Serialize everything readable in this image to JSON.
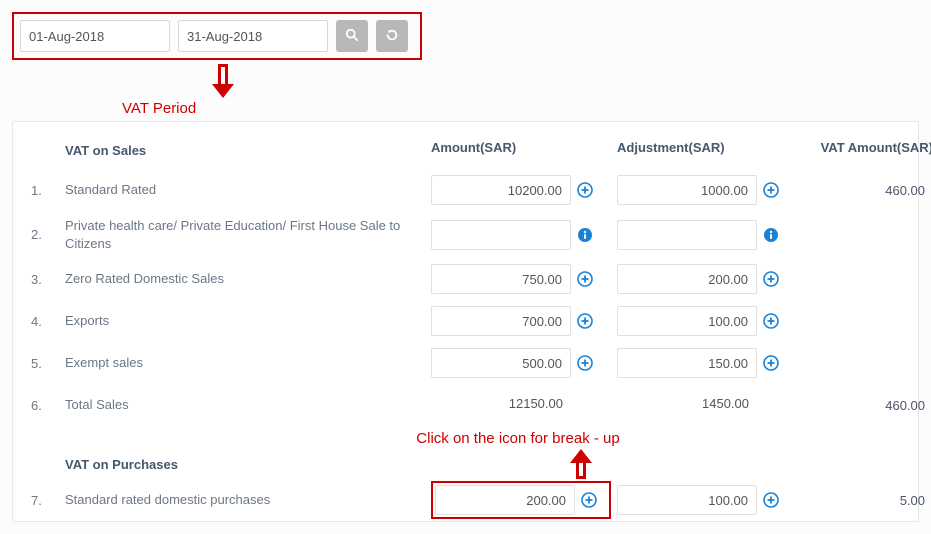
{
  "period": {
    "from": "01-Aug-2018",
    "to": "31-Aug-2018"
  },
  "annotations": {
    "vat_period": "VAT Period",
    "breakup": "Click on the icon for break - up"
  },
  "headers": {
    "amount": "Amount(SAR)",
    "adjustment": "Adjustment(SAR)",
    "vat_amount": "VAT Amount(SAR)"
  },
  "sections": {
    "sales": "VAT on Sales",
    "purchases": "VAT on Purchases"
  },
  "rows": {
    "r1": {
      "num": "1.",
      "label": "Standard Rated",
      "amount": "10200.00",
      "adjustment": "1000.00",
      "vat": "460.00"
    },
    "r2": {
      "num": "2.",
      "label": "Private health care/ Private Education/ First House Sale to Citizens",
      "amount": "",
      "adjustment": "",
      "vat": ""
    },
    "r3": {
      "num": "3.",
      "label": "Zero Rated Domestic Sales",
      "amount": "750.00",
      "adjustment": "200.00",
      "vat": ""
    },
    "r4": {
      "num": "4.",
      "label": "Exports",
      "amount": "700.00",
      "adjustment": "100.00",
      "vat": ""
    },
    "r5": {
      "num": "5.",
      "label": "Exempt sales",
      "amount": "500.00",
      "adjustment": "150.00",
      "vat": ""
    },
    "r6": {
      "num": "6.",
      "label": "Total Sales",
      "amount": "12150.00",
      "adjustment": "1450.00",
      "vat": "460.00"
    },
    "r7": {
      "num": "7.",
      "label": "Standard rated domestic purchases",
      "amount": "200.00",
      "adjustment": "100.00",
      "vat": "5.00"
    }
  }
}
